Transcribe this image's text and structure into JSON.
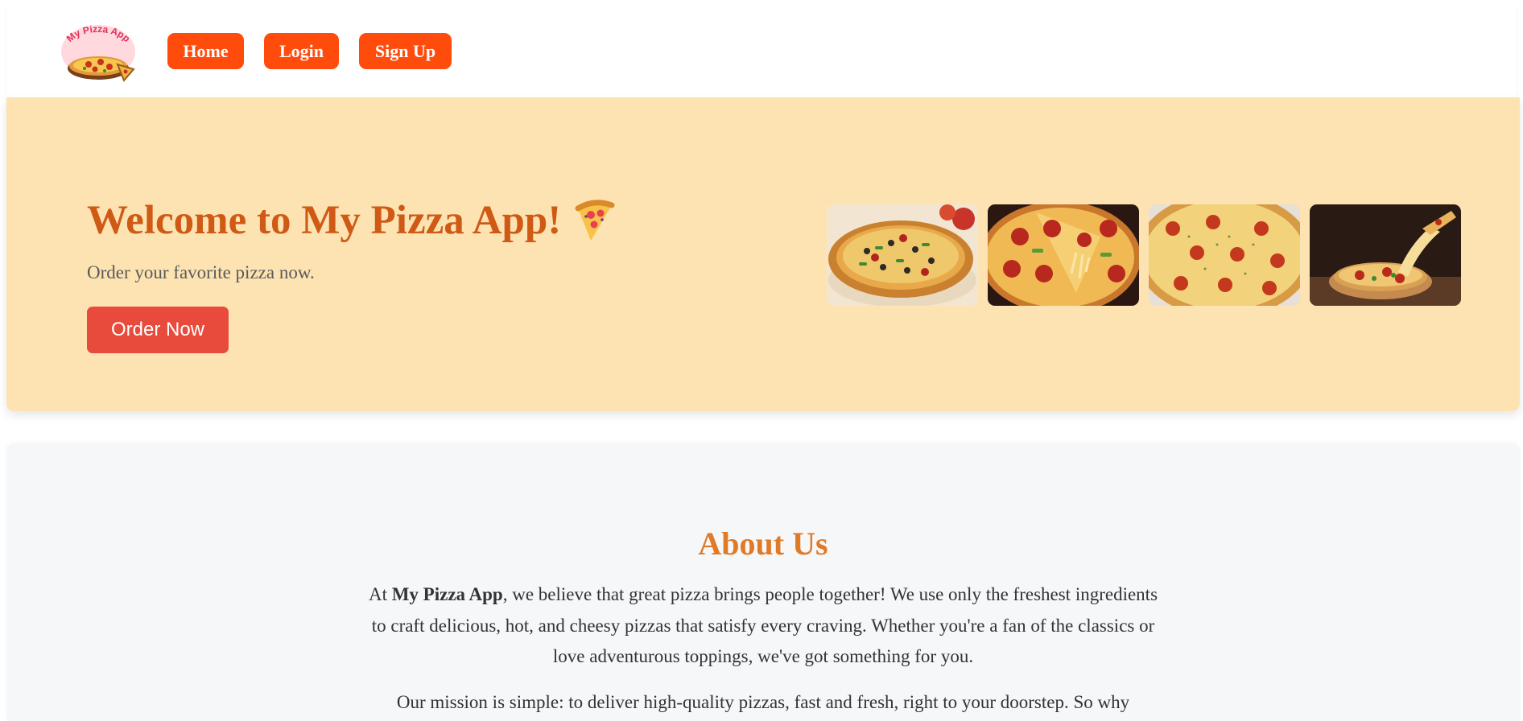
{
  "navbar": {
    "logo_text": "My Pizza App",
    "items": [
      {
        "label": "Home"
      },
      {
        "label": "Login"
      },
      {
        "label": "Sign Up"
      }
    ]
  },
  "hero": {
    "title": "Welcome to My Pizza App!",
    "title_emoji": "pizza-slice-icon",
    "subtitle": "Order your favorite pizza now.",
    "cta_label": "Order Now",
    "gallery": [
      {
        "name": "pizza-photo-supreme"
      },
      {
        "name": "pizza-photo-pepperoni-slice"
      },
      {
        "name": "pizza-photo-pepperoni-cheese"
      },
      {
        "name": "pizza-photo-cheese-pull"
      }
    ]
  },
  "about": {
    "title": "About Us",
    "p1_prefix": "At ",
    "p1_brand": "My Pizza App",
    "p1_rest": ", we believe that great pizza brings people together! We use only the freshest ingredients to craft delicious, hot, and cheesy pizzas that satisfy every craving. Whether you're a fan of the classics or love adventurous toppings, we've got something for you.",
    "p2": "Our mission is simple: to deliver high-quality pizzas, fast and fresh, right to your doorstep. So why"
  },
  "colors": {
    "nav_button": "#ff4c0c",
    "hero_bg": "#fde3b2",
    "hero_title": "#cf5a16",
    "cta_button": "#e84b3c",
    "about_title": "#e07a26",
    "about_bg": "#f6f7f9"
  }
}
